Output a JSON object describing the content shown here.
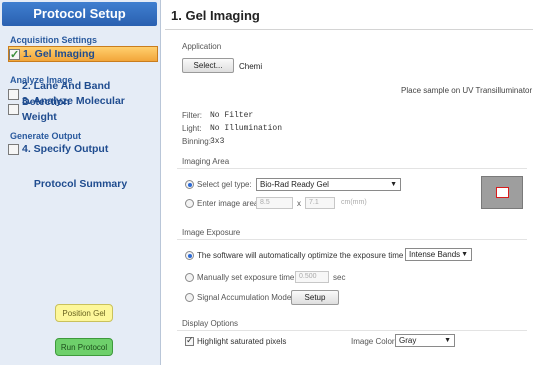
{
  "sidebar": {
    "title": "Protocol Setup",
    "acquisition_title": "Acquisition Settings",
    "steps": [
      {
        "label": "1. Gel Imaging",
        "checked": true,
        "active": true
      },
      {
        "label": "2. Lane And Band Detection",
        "checked": false
      },
      {
        "label": "3. Analyze Molecular Weight",
        "checked": false
      },
      {
        "label": "4. Specify Output",
        "checked": false
      }
    ],
    "analyze_title": "Analyze Image",
    "generate_title": "Generate Output",
    "summary": "Protocol Summary",
    "position_gel": "Position Gel",
    "run_protocol": "Run Protocol"
  },
  "main": {
    "title": "1. Gel Imaging",
    "application": {
      "label": "Application",
      "select_button": "Select...",
      "value": "Chemi",
      "note": "Place sample on UV Transilluminator"
    },
    "filter": {
      "label": "Filter:",
      "value": "No Filter"
    },
    "light": {
      "label": "Light:",
      "value": "No Illumination"
    },
    "binning": {
      "label": "Binning:",
      "value": "3x3"
    },
    "imaging_area": {
      "label": "Imaging Area",
      "gel_type_label": "Select gel type:",
      "gel_type_value": "Bio-Rad Ready Gel",
      "enter_area_label": "Enter image area:",
      "width": "8.5",
      "x_sep": "x",
      "height": "7.1",
      "units": "cm(mm)"
    },
    "image_exposure": {
      "label": "Image Exposure",
      "auto_label": "The software will automatically optimize the exposure time for",
      "auto_value": "Intense Bands",
      "manual_label": "Manually set exposure time:",
      "manual_value": "0.500",
      "manual_unit": "sec",
      "signal_label": "Signal Accumulation Mode",
      "setup_button": "Setup"
    },
    "display_options": {
      "label": "Display Options",
      "highlight_label": "Highlight saturated pixels",
      "highlight_checked": true,
      "image_color_label": "Image Color:",
      "image_color_value": "Gray"
    }
  },
  "colors": {
    "sidebar_header": "#2a60b0",
    "active_step": "#f2a53a",
    "position_gel": "#fdf79a",
    "run_protocol": "#6ed06b",
    "radio_selected": "#2d6bd6",
    "preview_border": "#d81b1b"
  }
}
